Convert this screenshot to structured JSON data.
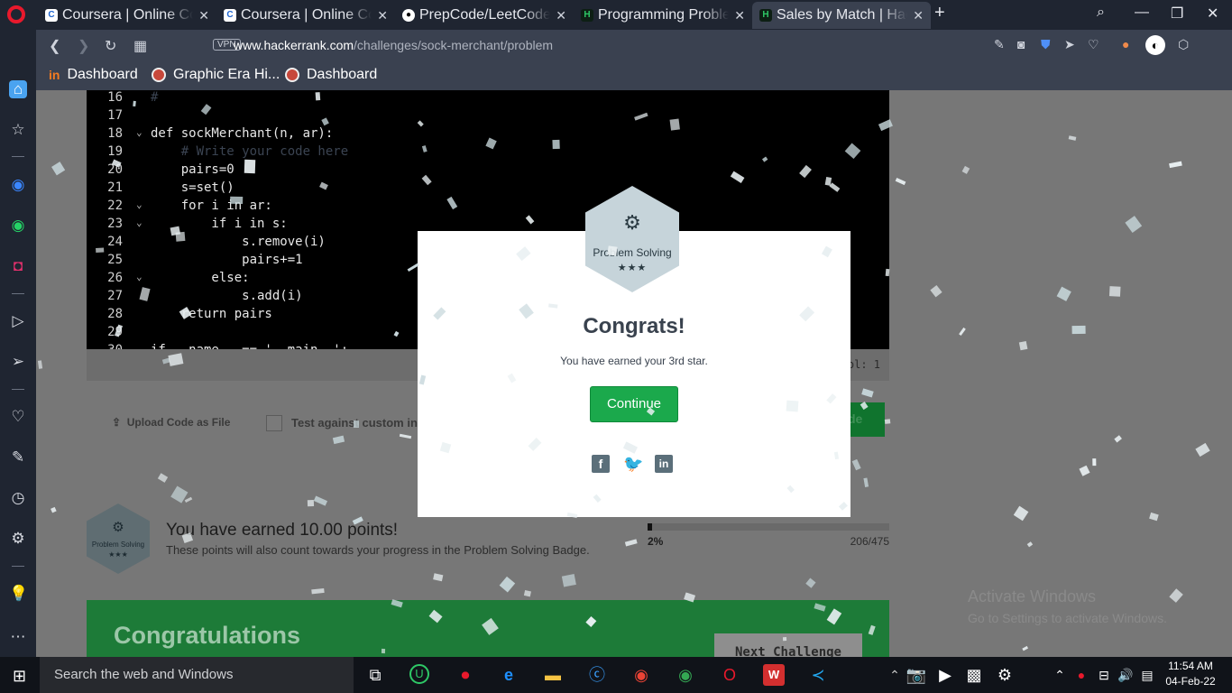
{
  "browser": {
    "tabs": [
      {
        "title": "Coursera | Online Courses",
        "active": false,
        "favicon": "coursera-icon"
      },
      {
        "title": "Coursera | Online Courses",
        "active": false,
        "favicon": "coursera-icon"
      },
      {
        "title": "PrepCode/LeetCode",
        "active": false,
        "favicon": "github-icon"
      },
      {
        "title": "Programming Problems",
        "active": false,
        "favicon": "hackerrank-icon"
      },
      {
        "title": "Sales by Match | HackerRank",
        "active": true,
        "favicon": "hackerrank-icon"
      }
    ],
    "new_tab_symbol": "+",
    "url_domain": "www.hackerrank.com",
    "url_path": "/challenges/sock-merchant/problem",
    "vpn_label": "VPN",
    "bookmarks": [
      {
        "label": "Dashboard",
        "icon": "dashboard-icon"
      },
      {
        "label": "Graphic Era Hi...",
        "icon": "graphic-era-icon"
      },
      {
        "label": "Dashboard",
        "icon": "dashboard-icon"
      }
    ]
  },
  "editor": {
    "lines": [
      {
        "n": "16",
        "text": "#"
      },
      {
        "n": "17",
        "text": ""
      },
      {
        "n": "18",
        "text": "def sockMerchant(n, ar):"
      },
      {
        "n": "19",
        "text": "    # Write your code here"
      },
      {
        "n": "20",
        "text": "    pairs=0"
      },
      {
        "n": "21",
        "text": "    s=set()"
      },
      {
        "n": "22",
        "text": "    for i in ar:"
      },
      {
        "n": "23",
        "text": "        if i in s:"
      },
      {
        "n": "24",
        "text": "            s.remove(i)"
      },
      {
        "n": "25",
        "text": "            pairs+=1"
      },
      {
        "n": "26",
        "text": "        else:"
      },
      {
        "n": "27",
        "text": "            s.add(i)"
      },
      {
        "n": "28",
        "text": "    return pairs"
      },
      {
        "n": "29",
        "text": ""
      },
      {
        "n": "30",
        "text": "if __name__ == '__main__':"
      }
    ],
    "cursor_status": "ol: 1",
    "upload_label": "Upload Code as File",
    "custom_input_label": "Test against custom input",
    "submit_label_fragment": "de"
  },
  "points": {
    "badge_name": "Problem Solving",
    "badge_stars": "★★★",
    "headline": "You have earned 10.00 points!",
    "subline": "These points will also count towards your progress in the Problem Solving Badge.",
    "progress_percent_label": "2%",
    "progress_fraction": 0.02,
    "progress_count": "206/475"
  },
  "congrats_banner": {
    "title": "Congratulations",
    "next_button": "Next Challenge"
  },
  "modal": {
    "badge_name": "Problem Solving",
    "badge_stars": "★★★",
    "title": "Congrats!",
    "message": "You have earned your 3rd star.",
    "continue_label": "Continue",
    "share_icons": [
      "facebook-icon",
      "twitter-icon",
      "linkedin-icon"
    ]
  },
  "watermark": {
    "line1": "Activate Windows",
    "line2": "Go to Settings to activate Windows."
  },
  "taskbar": {
    "search_placeholder": "Search the web and Windows",
    "time": "11:54 AM",
    "date": "04-Feb-22"
  },
  "colors": {
    "accent_green": "#1ba94c",
    "banner_green": "#1d7b38",
    "opera_red": "#e8192c"
  }
}
